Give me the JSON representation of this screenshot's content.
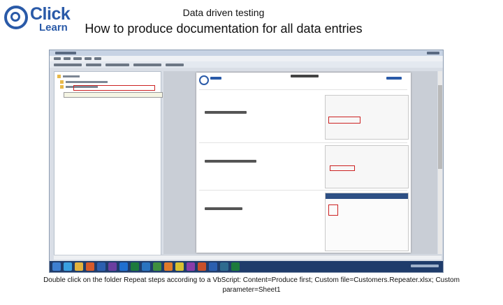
{
  "header": {
    "logo": {
      "word1": "Click",
      "word2": "Learn"
    },
    "title": "Data driven testing",
    "subtitle": "How to produce documentation for all data entries"
  },
  "caption": "Double click on the folder Repeat steps according to a VbScript: Content=Produce first; Custom file=Customers.Repeater.xlsx; Custom parameter=Sheet1",
  "colors": {
    "brand": "#2a5aa8",
    "highlight": "#cc2222",
    "taskbar": "#1f3c6b"
  },
  "screenshot": {
    "taskbar_icons": [
      "start-icon",
      "ie-icon",
      "explorer-icon",
      "media-icon",
      "word-icon",
      "vs-icon",
      "outlook-icon",
      "excel-icon",
      "dynamics-icon",
      "project-icon",
      "firefox-icon",
      "chrome-icon",
      "onenote-icon",
      "powerpoint-icon",
      "word2-icon",
      "app-icon",
      "excel2-icon"
    ]
  }
}
